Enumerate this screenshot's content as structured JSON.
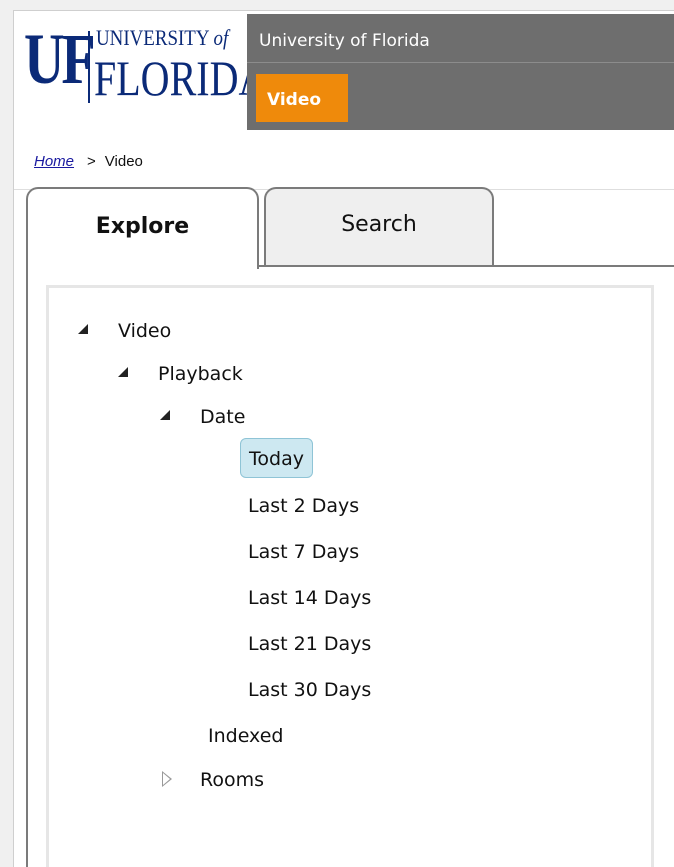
{
  "header": {
    "logo": {
      "uf": "UF",
      "university": "UNIVERSITY",
      "of": "of",
      "florida": "FLORIDA"
    },
    "site_name": "University of Florida",
    "nav_tab": "Video"
  },
  "breadcrumb": {
    "home": "Home",
    "separator": ">",
    "current": "Video"
  },
  "tabs": {
    "explore": "Explore",
    "search": "Search",
    "active": "Explore"
  },
  "tree": {
    "video": "Video",
    "playback": "Playback",
    "date": "Date",
    "dates": [
      "Today",
      "Last 2 Days",
      "Last 7 Days",
      "Last 14 Days",
      "Last 21 Days",
      "Last 30 Days"
    ],
    "selected": "Today",
    "indexed": "Indexed",
    "rooms": "Rooms"
  },
  "colors": {
    "brand_blue": "#0b2a78",
    "header_gray": "#6e6e6e",
    "accent_orange": "#ef8a0b",
    "selection_bg": "#cde8f1"
  }
}
